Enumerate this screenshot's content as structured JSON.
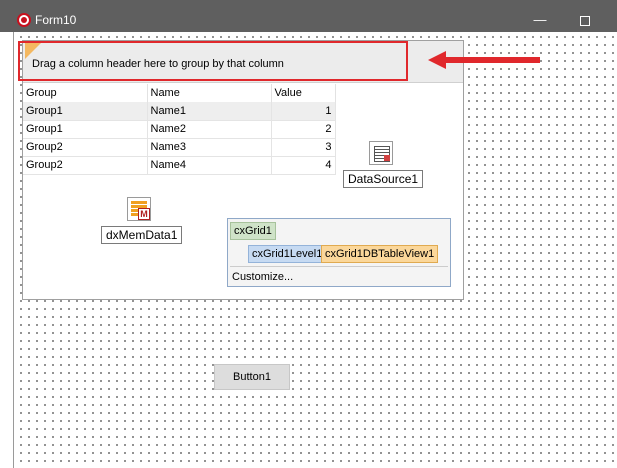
{
  "window": {
    "title": "Form10",
    "minimize_glyph": "—",
    "icon": "delphi-app-icon"
  },
  "grid": {
    "group_by_text": "Drag a column header here to group by that column",
    "columns": [
      "Group",
      "Name",
      "Value"
    ],
    "rows": [
      {
        "group": "Group1",
        "name": "Name1",
        "value": "1"
      },
      {
        "group": "Group1",
        "name": "Name2",
        "value": "2"
      },
      {
        "group": "Group2",
        "name": "Name3",
        "value": "3"
      },
      {
        "group": "Group2",
        "name": "Name4",
        "value": "4"
      }
    ]
  },
  "components": {
    "datasource": {
      "label": "DataSource1",
      "icon": "datasource-icon"
    },
    "memdata": {
      "label": "dxMemData1",
      "icon": "memdata-icon",
      "icon_letter": "M"
    }
  },
  "structure": {
    "grid_name": "cxGrid1",
    "level_name": "cxGrid1Level1",
    "view_name": "cxGrid1DBTableView1",
    "customize_label": "Customize..."
  },
  "button": {
    "label": "Button1"
  },
  "annotation": {
    "color": "#e0282c"
  }
}
